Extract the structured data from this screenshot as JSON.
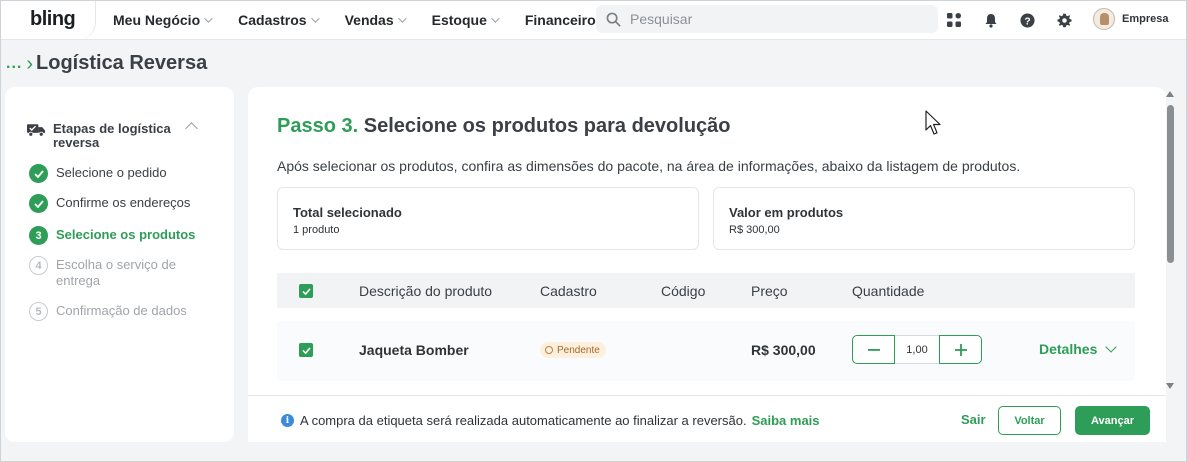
{
  "topbar": {
    "logo": "bling",
    "menu": [
      {
        "label": "Meu Negócio"
      },
      {
        "label": "Cadastros"
      },
      {
        "label": "Vendas"
      },
      {
        "label": "Estoque"
      },
      {
        "label": "Financeiro"
      }
    ],
    "search_placeholder": "Pesquisar",
    "icons": [
      "apps-icon",
      "bell-icon",
      "help-icon",
      "gear-icon"
    ],
    "company": "Empresa"
  },
  "breadcrumb": {
    "ellipsis": "...",
    "title": "Logística Reversa"
  },
  "steps": {
    "title": "Etapas de logística reversa",
    "items": [
      {
        "label": "Selecione o pedido",
        "state": "done",
        "number": "1"
      },
      {
        "label": "Confirme os endereços",
        "state": "done",
        "number": "2"
      },
      {
        "label": "Selecione os produtos",
        "state": "active",
        "number": "3"
      },
      {
        "label": "Escolha o serviço de entrega",
        "state": "todo",
        "number": "4"
      },
      {
        "label": "Confirmação de dados",
        "state": "todo",
        "number": "5"
      }
    ]
  },
  "main": {
    "step_number": "Passo 3.",
    "step_title": "Selecione os produtos para devolução",
    "subtitle": "Após selecionar os produtos, confira as dimensões do pacote, na área de informações, abaixo da listagem de produtos.",
    "cards": [
      {
        "label": "Total selecionado",
        "value": "1 produto"
      },
      {
        "label": "Valor em produtos",
        "value": "R$ 300,00"
      }
    ],
    "table": {
      "columns": [
        "Descrição do produto",
        "Cadastro",
        "Código",
        "Preço",
        "Quantidade"
      ],
      "rows": [
        {
          "description": "Jaqueta Bomber",
          "status": "Pendente",
          "code": "",
          "price": "R$ 300,00",
          "quantity": "1,00",
          "details_label": "Detalhes"
        }
      ]
    }
  },
  "footer": {
    "note": "A compra da etiqueta será realizada automaticamente ao finalizar a reversão.",
    "link": "Saiba mais",
    "exit_label": "Sair",
    "back_label": "Voltar",
    "next_label": "Avançar"
  },
  "colors": {
    "accent": "#2e9d57",
    "badge_bg": "#fdf0de",
    "badge_text": "#a4682b",
    "info": "#3d8bd8"
  }
}
